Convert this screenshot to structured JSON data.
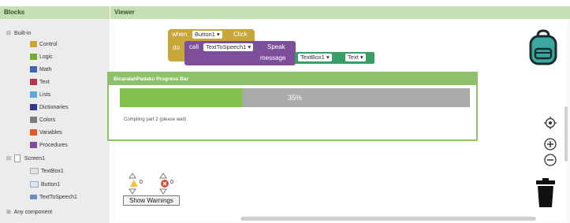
{
  "blocks_panel": {
    "title": "Blocks",
    "tree": {
      "builtin": {
        "label": "Built-in",
        "items": [
          {
            "label": "Control",
            "color": "#c8a63a"
          },
          {
            "label": "Logic",
            "color": "#76a934"
          },
          {
            "label": "Math",
            "color": "#3f65b4"
          },
          {
            "label": "Text",
            "color": "#b8324f"
          },
          {
            "label": "Lists",
            "color": "#5fa7d8"
          },
          {
            "label": "Dictionaries",
            "color": "#2d3a8c"
          },
          {
            "label": "Colors",
            "color": "#7a7a7a"
          },
          {
            "label": "Variables",
            "color": "#dc5e2a"
          },
          {
            "label": "Procedures",
            "color": "#7d4f9b"
          }
        ]
      },
      "screen": {
        "label": "Screen1",
        "items": [
          {
            "label": "TextBox1"
          },
          {
            "label": "Button1"
          },
          {
            "label": "TextToSpeech1"
          }
        ]
      },
      "any": {
        "label": "Any component"
      }
    }
  },
  "viewer": {
    "title": "Viewer",
    "event_block": {
      "when": "when",
      "component": "Button1",
      "event": "Click",
      "do": "do",
      "color": "#c8a63a"
    },
    "call_block": {
      "call": "call",
      "component": "TextToSpeech1",
      "method": "Speak",
      "param": "message",
      "color": "#7d4f9b"
    },
    "textbox_getter": {
      "component": "TextBox1",
      "property": "Text",
      "color": "#3c9e67"
    },
    "progress_dialog": {
      "title": "BicaralahPadaku Progress Bar",
      "percent_label": "35%",
      "progress": 0.35,
      "status": "Compiling part 2 (please wait)"
    },
    "warnings": {
      "warn_count": "0",
      "error_count": "0",
      "button_label": "Show Warnings"
    }
  }
}
